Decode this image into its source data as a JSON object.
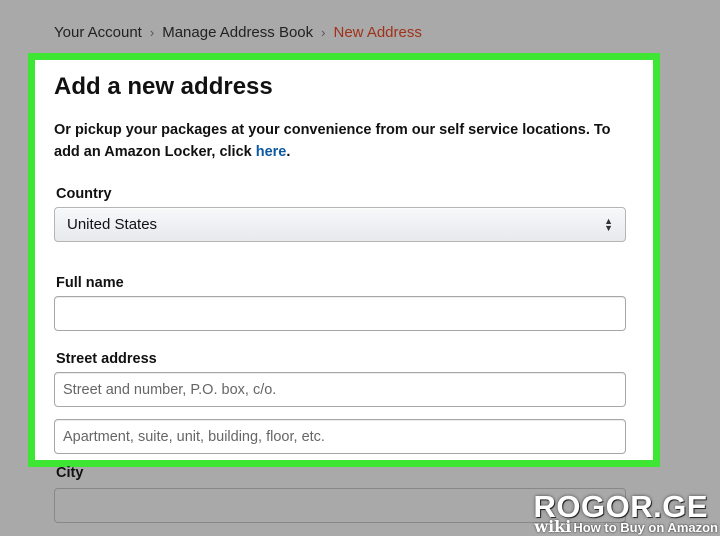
{
  "breadcrumb": {
    "items": [
      "Your Account",
      "Manage Address Book"
    ],
    "current": "New Address",
    "separator": "›"
  },
  "form": {
    "title": "Add a new address",
    "description": "Or pickup your packages at your convenience from our self service locations. To add an Amazon Locker, click ",
    "description_link": "here",
    "description_end": ".",
    "country_label": "Country",
    "country_value": "United States",
    "full_name_label": "Full name",
    "full_name_value": "",
    "street_label": "Street address",
    "street_line1_placeholder": "Street and number, P.O. box, c/o.",
    "street_line2_placeholder": "Apartment, suite, unit, building, floor, etc.",
    "city_label": "City"
  },
  "watermark": {
    "main": "ROGOR.GE",
    "wiki": "wiki",
    "caption": "How to Buy on Amazon"
  },
  "colors": {
    "highlight_border": "#3ee634",
    "link": "#0b5aa2",
    "breadcrumb_current": "#a0321a",
    "dim_background": "#a9a9a9"
  },
  "icons": {
    "select_arrows": "up-down-chevron-icon"
  }
}
